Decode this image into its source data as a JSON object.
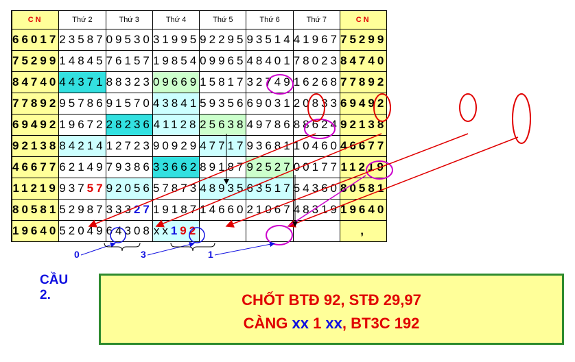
{
  "header": {
    "left": "CN",
    "days": [
      "Thứ 2",
      "Thứ 3",
      "Thứ 4",
      "Thứ 5",
      "Thứ 6",
      "Thứ 7"
    ],
    "right": "CN"
  },
  "rows": [
    {
      "swatch": "#ff99cc",
      "left": "66017",
      "days": [
        "23587",
        "09530",
        "31995",
        "92295",
        "93514",
        "41967"
      ],
      "right": "75299"
    },
    {
      "swatch": "#00e5e5",
      "left": "75299",
      "days": [
        "14845",
        "76157",
        "19854",
        "09965",
        "48401",
        "78023"
      ],
      "right": "84740"
    },
    {
      "swatch": "#ff6600",
      "left": "84740",
      "days": [
        "44371",
        "88323",
        "09669",
        "15817",
        "32749",
        "16268"
      ],
      "right": "77892"
    },
    {
      "swatch": "#ffffff",
      "left": "77892",
      "days": [
        "95786",
        "91570",
        "43841",
        "59356",
        "69031",
        "20833"
      ],
      "right": "69492"
    },
    {
      "swatch": "#ffff00",
      "left": "69492",
      "days": [
        "19672",
        "28236",
        "41128",
        "25638",
        "49786",
        "88624"
      ],
      "right": "92138"
    },
    {
      "swatch": "#ff99cc",
      "left": "92138",
      "days": [
        "84214",
        "12723",
        "90929",
        "47717",
        "93681",
        "10460"
      ],
      "right": "46677"
    },
    {
      "swatch": "#00e5e5",
      "left": "46677",
      "days": [
        "62149",
        "79386",
        "33662",
        "89187",
        "92527",
        "00177"
      ],
      "right": "11219"
    },
    {
      "swatch": "#ff6600",
      "left": "11219",
      "days": [
        "93757",
        "92056",
        "57873",
        "48935",
        "63517",
        "54360"
      ],
      "right": "80581"
    },
    {
      "swatch": "#ffffff",
      "left": "80581",
      "days": [
        "52987",
        "33327",
        "19187",
        "14660",
        "21067",
        "48319"
      ],
      "right": "19640"
    },
    {
      "swatch": "#ffff00",
      "left": "19640",
      "days": [
        "52049",
        "64308",
        "xx192",
        "",
        "",
        ""
      ],
      "right": ","
    }
  ],
  "under_numbers": [
    "0",
    "3",
    "1"
  ],
  "cau_label": "CẦU 2.",
  "verdict": {
    "line1": "CHỐT BTĐ 92, STĐ 29,97",
    "line2_a": "CÀNG ",
    "line2_b": "xx",
    "line2_c": " 1 ",
    "line2_d": "xx",
    "line2_e": ", BT3C 192"
  },
  "colors": {
    "accent_red": "#e00000",
    "accent_blue": "#1010e0",
    "panel_yellow": "#ffff99",
    "panel_border": "#2e8b2e",
    "oval_magenta": "#cc00cc"
  }
}
